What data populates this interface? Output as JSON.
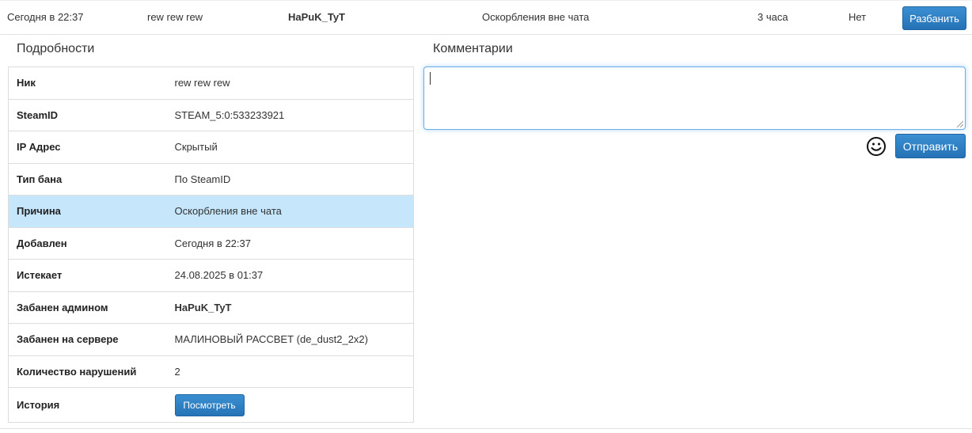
{
  "ban_row": {
    "date": "Сегодня в 22:37",
    "nick": "rew rew rew",
    "admin": "HaPuK_TyT",
    "reason": "Оскорбления вне чата",
    "duration": "3 часа",
    "status": "Нет",
    "unban_label": "Разбанить"
  },
  "details": {
    "title": "Подробности",
    "rows": [
      {
        "key": "Ник",
        "value": "rew rew rew"
      },
      {
        "key": "SteamID",
        "value": "STEAM_5:0:533233921"
      },
      {
        "key": "IP Адрес",
        "value": "Скрытый"
      },
      {
        "key": "Тип бана",
        "value": "По SteamID"
      },
      {
        "key": "Причина",
        "value": "Оскорбления вне чата"
      },
      {
        "key": "Добавлен",
        "value": "Сегодня в 22:37"
      },
      {
        "key": "Истекает",
        "value": "24.08.2025 в 01:37"
      },
      {
        "key": "Забанен админом",
        "value": "HaPuK_TyT"
      },
      {
        "key": "Забанен на сервере",
        "value": "МАЛИНОВЫЙ РАССВЕТ (de_dust2_2x2)"
      },
      {
        "key": "Количество нарушений",
        "value": "2"
      },
      {
        "key": "История",
        "button_label": "Посмотреть"
      }
    ]
  },
  "comments": {
    "title": "Комментарии",
    "input_value": "",
    "send_label": "Отправить",
    "emoji_icon": "smiley-face-icon"
  },
  "colors": {
    "accent": "#2a7bbf",
    "highlight_row": "#c6e6fb",
    "focus_border": "#66afe9"
  }
}
